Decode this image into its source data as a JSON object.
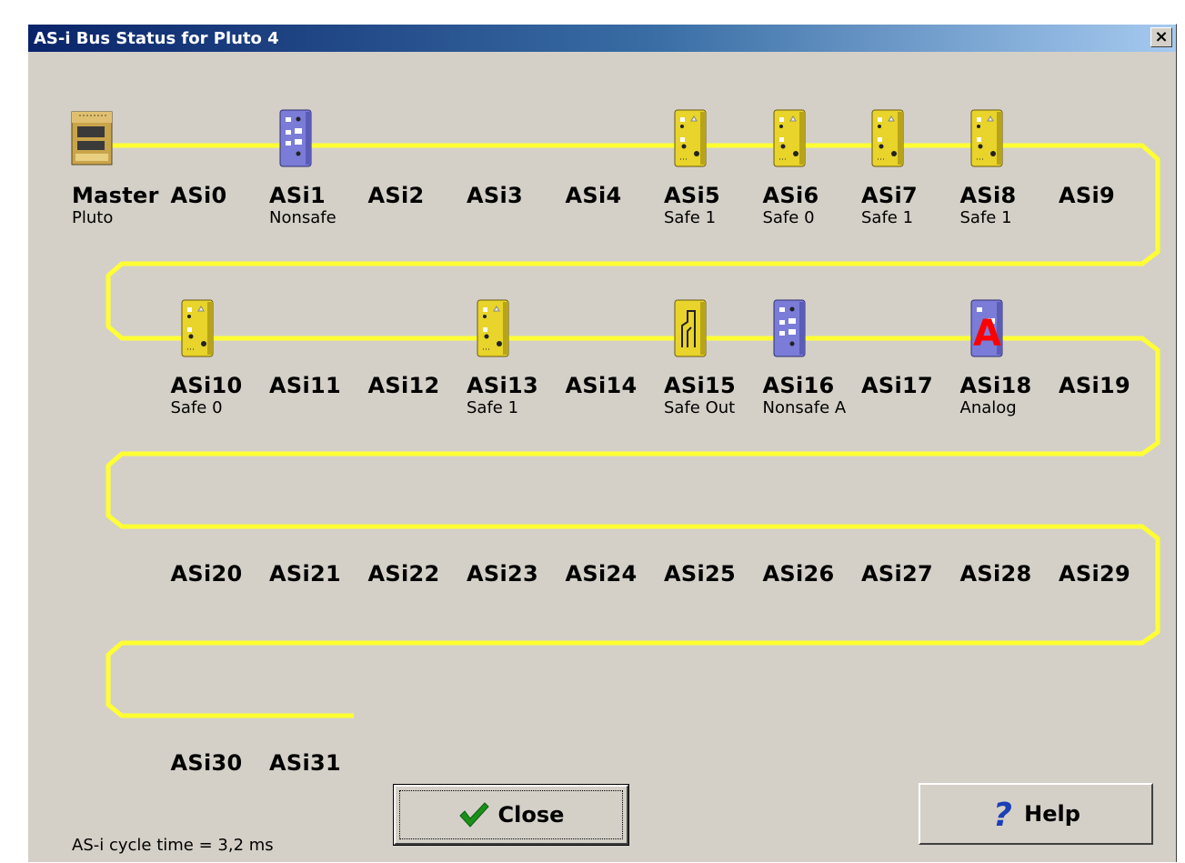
{
  "window": {
    "title": "AS-i Bus Status for Pluto 4",
    "close_glyph": "×"
  },
  "colors": {
    "bus": "#ffff33",
    "safe": "#e8d42a",
    "nonsafe": "#7a7cd8",
    "analog_mark": "#ff0000"
  },
  "nodes": [
    {
      "name": "Master",
      "type": "Pluto",
      "icon": "pluto-master-icon"
    },
    {
      "name": "ASi0",
      "type": "",
      "icon": ""
    },
    {
      "name": "ASi1",
      "type": "Nonsafe",
      "icon": "nonsafe-module-icon"
    },
    {
      "name": "ASi2",
      "type": "",
      "icon": ""
    },
    {
      "name": "ASi3",
      "type": "",
      "icon": ""
    },
    {
      "name": "ASi4",
      "type": "",
      "icon": ""
    },
    {
      "name": "ASi5",
      "type": "Safe 1",
      "icon": "safe-module-icon"
    },
    {
      "name": "ASi6",
      "type": "Safe 0",
      "icon": "safe-module-icon"
    },
    {
      "name": "ASi7",
      "type": "Safe 1",
      "icon": "safe-module-icon"
    },
    {
      "name": "ASi8",
      "type": "Safe 1",
      "icon": "safe-module-icon"
    },
    {
      "name": "ASi9",
      "type": "",
      "icon": ""
    },
    {
      "name": "ASi10",
      "type": "Safe 0",
      "icon": "safe-module-icon"
    },
    {
      "name": "ASi11",
      "type": "",
      "icon": ""
    },
    {
      "name": "ASi12",
      "type": "",
      "icon": ""
    },
    {
      "name": "ASi13",
      "type": "Safe 1",
      "icon": "safe-module-icon"
    },
    {
      "name": "ASi14",
      "type": "",
      "icon": ""
    },
    {
      "name": "ASi15",
      "type": "Safe Out",
      "icon": "safe-output-module-icon"
    },
    {
      "name": "ASi16",
      "type": "Nonsafe A",
      "icon": "nonsafe-module-icon"
    },
    {
      "name": "ASi17",
      "type": "",
      "icon": ""
    },
    {
      "name": "ASi18",
      "type": "Analog",
      "icon": "analog-module-icon"
    },
    {
      "name": "ASi19",
      "type": "",
      "icon": ""
    },
    {
      "name": "ASi20",
      "type": "",
      "icon": ""
    },
    {
      "name": "ASi21",
      "type": "",
      "icon": ""
    },
    {
      "name": "ASi22",
      "type": "",
      "icon": ""
    },
    {
      "name": "ASi23",
      "type": "",
      "icon": ""
    },
    {
      "name": "ASi24",
      "type": "",
      "icon": ""
    },
    {
      "name": "ASi25",
      "type": "",
      "icon": ""
    },
    {
      "name": "ASi26",
      "type": "",
      "icon": ""
    },
    {
      "name": "ASi27",
      "type": "",
      "icon": ""
    },
    {
      "name": "ASi28",
      "type": "",
      "icon": ""
    },
    {
      "name": "ASi29",
      "type": "",
      "icon": ""
    },
    {
      "name": "ASi30",
      "type": "",
      "icon": ""
    },
    {
      "name": "ASi31",
      "type": "",
      "icon": ""
    }
  ],
  "buttons": {
    "close_label": "Close",
    "close_icon": "checkmark-icon",
    "help_label": "Help",
    "help_icon": "question-mark-icon"
  },
  "status": {
    "cycle_time": "AS-i cycle time = 3,2 ms"
  }
}
